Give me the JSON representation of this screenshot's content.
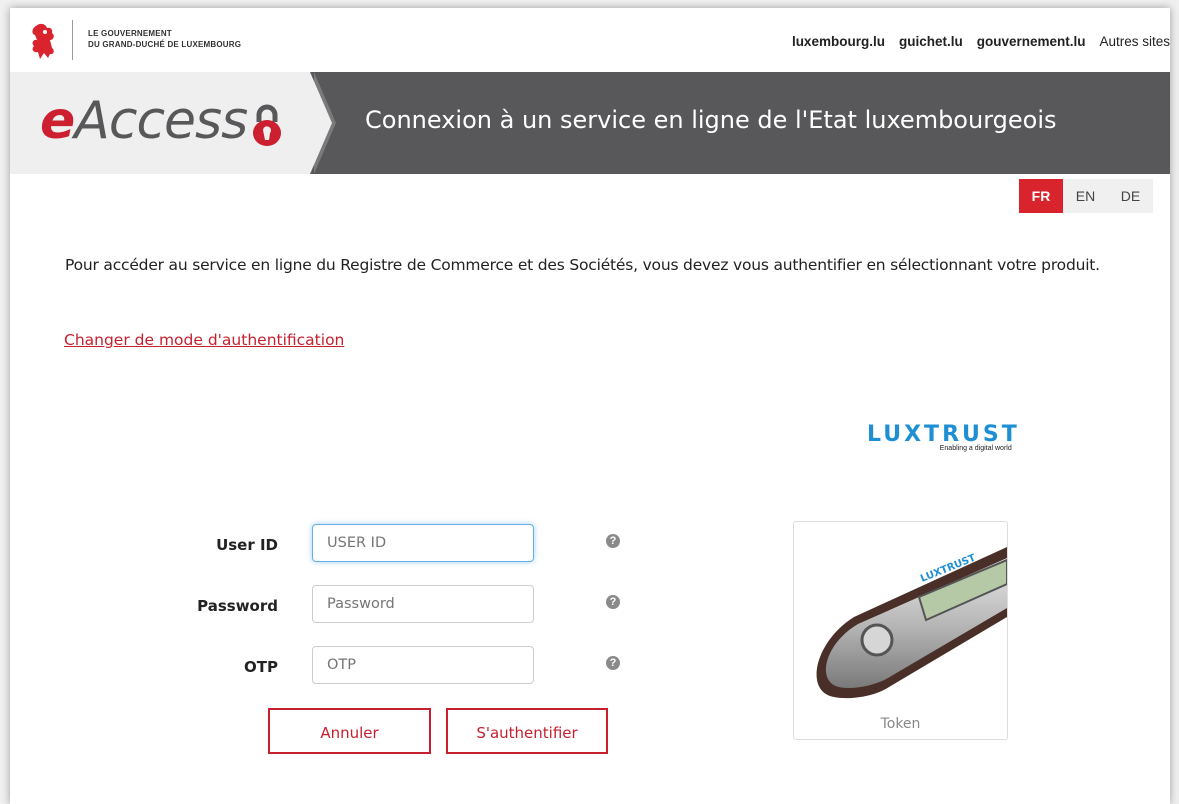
{
  "header": {
    "gov_line1": "LE GOUVERNEMENT",
    "gov_line2": "DU GRAND-DUCHÉ DE LUXEMBOURG",
    "links": [
      "luxembourg.lu",
      "guichet.lu",
      "gouvernement.lu",
      "Autres sites"
    ]
  },
  "banner": {
    "brand_e": "e",
    "brand_rest": "Access",
    "title": "Connexion à un service en ligne de l'Etat luxembourgeois"
  },
  "languages": [
    {
      "label": "FR",
      "active": true
    },
    {
      "label": "EN",
      "active": false
    },
    {
      "label": "DE",
      "active": false
    }
  ],
  "intro": "Pour accéder au service en ligne du Registre de Commerce et des Sociétés, vous devez vous authentifier en sélectionnant votre produit.",
  "change_auth_link": "Changer de mode d'authentification",
  "luxtrust": {
    "word": "LUXTRUST",
    "tagline": "Enabling a digital world"
  },
  "form": {
    "user_id_label": "User ID",
    "user_id_placeholder": "USER ID",
    "password_label": "Password",
    "password_placeholder": "Password",
    "otp_label": "OTP",
    "otp_placeholder": "OTP",
    "help_glyph": "?",
    "cancel": "Annuler",
    "submit": "S'authentifier"
  },
  "token": {
    "label": "Token",
    "device_text": "LUXTRUST"
  },
  "colors": {
    "accent": "#c6202f",
    "banner": "#58585a",
    "luxtrust_blue": "#1d8fd2"
  }
}
